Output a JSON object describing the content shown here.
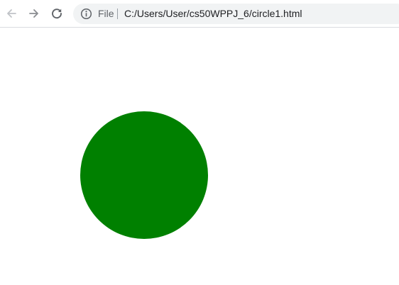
{
  "toolbar": {
    "back_icon": "arrow-left-icon",
    "forward_icon": "arrow-right-icon",
    "reload_icon": "reload-icon",
    "info_icon": "info-icon",
    "scheme_label": "File",
    "url": "C:/Users/User/cs50WPPJ_6/circle1.html"
  },
  "page": {
    "shape": "circle",
    "circle_color": "#008000"
  },
  "colors": {
    "omnibox_bg": "#f1f3f4",
    "icon_disabled": "#c0c3c7",
    "icon_active": "#5f6368"
  }
}
